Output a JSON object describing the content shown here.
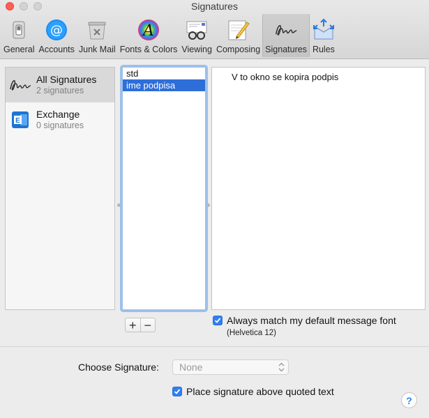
{
  "window": {
    "title": "Signatures"
  },
  "toolbar": {
    "items": [
      {
        "label": "General",
        "icon": "switch-icon"
      },
      {
        "label": "Accounts",
        "icon": "at-icon"
      },
      {
        "label": "Junk Mail",
        "icon": "trash-icon"
      },
      {
        "label": "Fonts & Colors",
        "icon": "font-icon"
      },
      {
        "label": "Viewing",
        "icon": "glasses-icon"
      },
      {
        "label": "Composing",
        "icon": "pencil-icon"
      },
      {
        "label": "Signatures",
        "icon": "signature-icon",
        "selected": true
      },
      {
        "label": "Rules",
        "icon": "rules-icon"
      }
    ]
  },
  "accounts": {
    "items": [
      {
        "name": "All Signatures",
        "count": "2 signatures",
        "selected": true
      },
      {
        "name": "Exchange",
        "count": "0 signatures"
      }
    ]
  },
  "signatures": {
    "items": [
      {
        "name": "std"
      },
      {
        "name": "ime podpisa",
        "selected": true
      }
    ]
  },
  "editor": {
    "content": "V to okno se kopira podpis"
  },
  "controls": {
    "add_label": "+",
    "remove_label": "−",
    "match_font_label": "Always match my default message font",
    "match_font_checked": true,
    "font_note": "(Helvetica 12)",
    "choose_label": "Choose Signature:",
    "choose_value": "None",
    "above_label": "Place signature above quoted text",
    "above_checked": true,
    "help": "?"
  },
  "colors": {
    "selection": "#2e6ed9",
    "checkbox": "#2f7ff2",
    "close": "#ff5f57"
  }
}
